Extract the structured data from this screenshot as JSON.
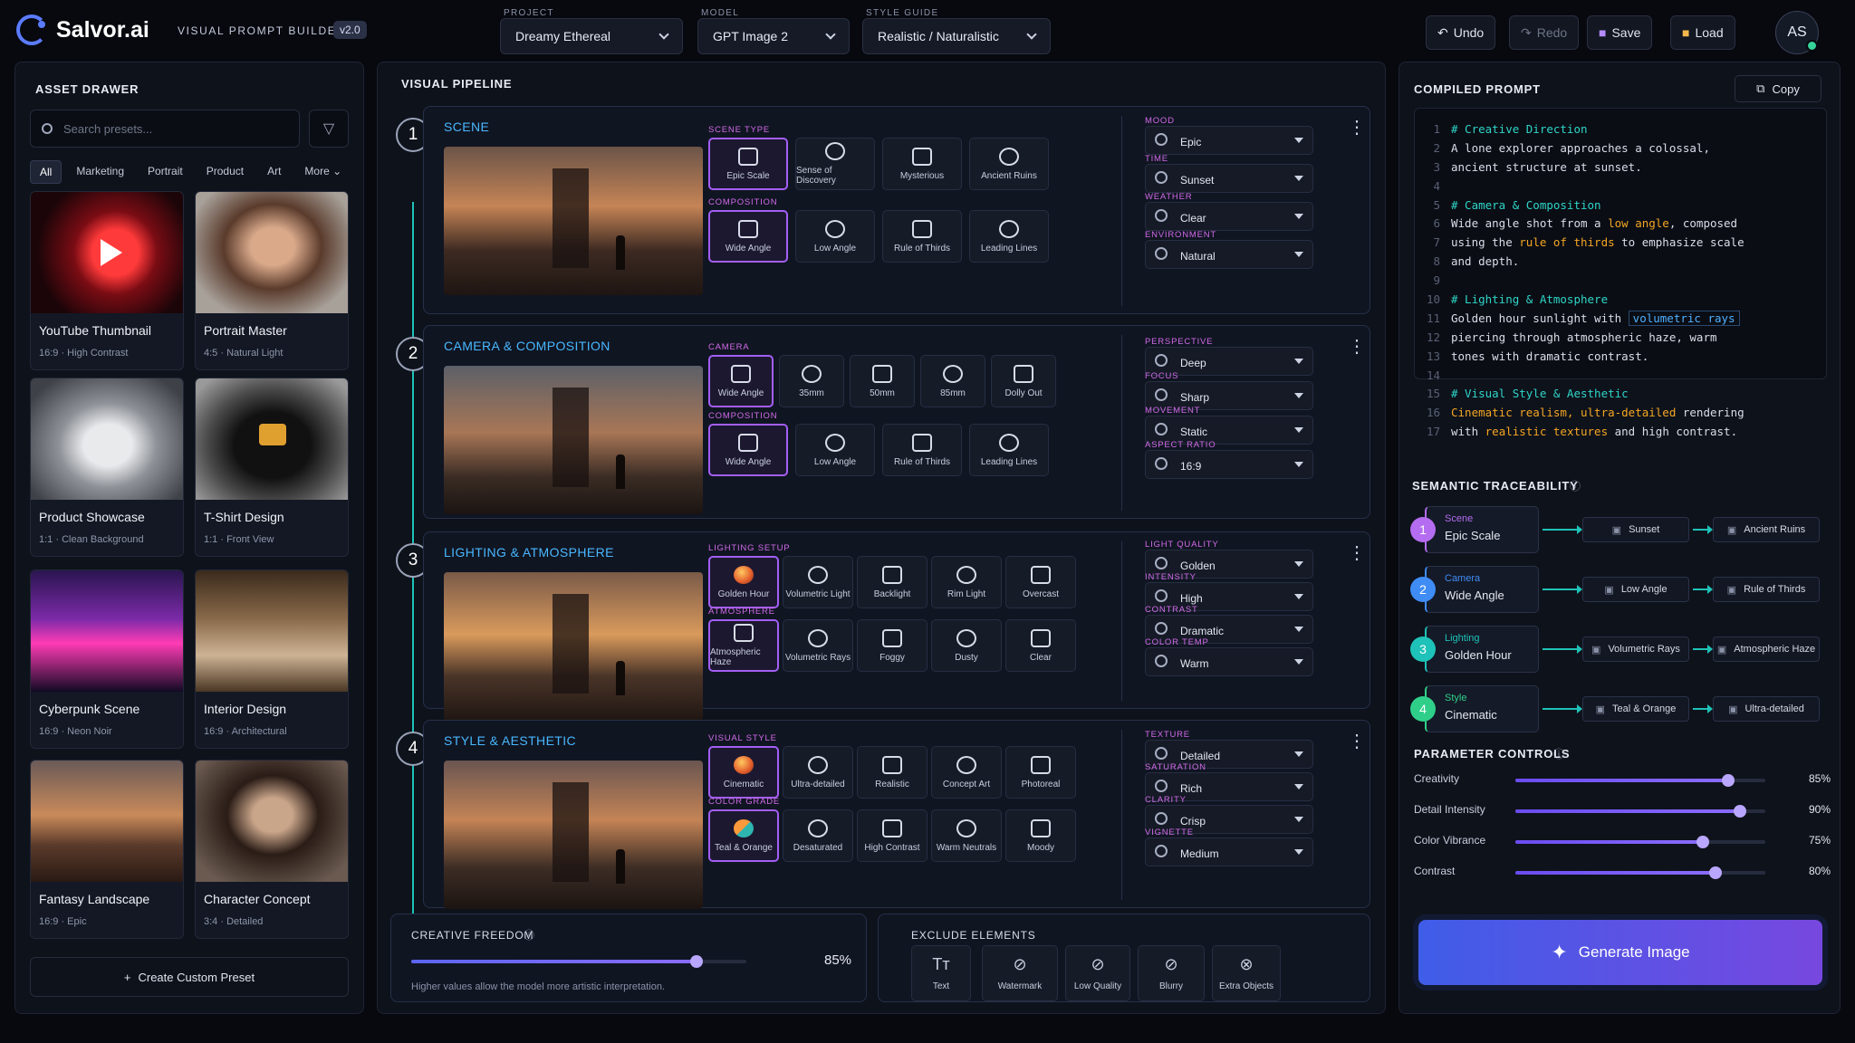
{
  "header": {
    "app_name": "Salvor.ai",
    "tool_name": "VISUAL PROMPT BUILDER",
    "version": "v2.0",
    "project_label": "PROJECT",
    "project_value": "Dreamy Ethereal",
    "model_label": "MODEL",
    "model_value": "GPT Image 2",
    "style_label": "STYLE GUIDE",
    "style_value": "Realistic / Naturalistic",
    "undo": "Undo",
    "redo": "Redo",
    "save": "Save",
    "load": "Load",
    "avatar": "AS"
  },
  "assets": {
    "title": "ASSET DRAWER",
    "search_placeholder": "Search presets...",
    "filters": [
      "All",
      "Marketing",
      "Portrait",
      "Product",
      "Art",
      "More"
    ],
    "cards": [
      {
        "title": "YouTube Thumbnail",
        "sub": "16:9 · High Contrast"
      },
      {
        "title": "Portrait Master",
        "sub": "4:5 · Natural Light"
      },
      {
        "title": "Product Showcase",
        "sub": "1:1 · Clean Background"
      },
      {
        "title": "T-Shirt Design",
        "sub": "1:1 · Front View"
      },
      {
        "title": "Cyberpunk Scene",
        "sub": "16:9 · Neon Noir"
      },
      {
        "title": "Interior Design",
        "sub": "16:9 · Architectural"
      },
      {
        "title": "Fantasy Landscape",
        "sub": "16:9 · Epic"
      },
      {
        "title": "Character Concept",
        "sub": "3:4 · Detailed"
      }
    ],
    "create": "Create Custom Preset"
  },
  "pipeline": {
    "title": "VISUAL PIPELINE",
    "stages": [
      {
        "num": "1",
        "title": "SCENE",
        "groups": [
          {
            "label": "SCENE TYPE",
            "options": [
              "Epic Scale",
              "Sense of Discovery",
              "Mysterious",
              "Ancient Ruins"
            ]
          },
          {
            "label": "COMPOSITION",
            "options": [
              "Wide Angle",
              "Low Angle",
              "Rule of Thirds",
              "Leading Lines"
            ]
          }
        ],
        "params": [
          {
            "label": "MOOD",
            "value": "Epic"
          },
          {
            "label": "TIME",
            "value": "Sunset"
          },
          {
            "label": "WEATHER",
            "value": "Clear"
          },
          {
            "label": "ENVIRONMENT",
            "value": "Natural"
          }
        ]
      },
      {
        "num": "2",
        "title": "CAMERA & COMPOSITION",
        "groups": [
          {
            "label": "CAMERA",
            "options": [
              "Wide Angle",
              "35mm",
              "50mm",
              "85mm",
              "Dolly Out"
            ]
          },
          {
            "label": "COMPOSITION",
            "options": [
              "Wide Angle",
              "Low Angle",
              "Rule of Thirds",
              "Leading Lines"
            ]
          }
        ],
        "params": [
          {
            "label": "PERSPECTIVE",
            "value": "Deep"
          },
          {
            "label": "FOCUS",
            "value": "Sharp"
          },
          {
            "label": "MOVEMENT",
            "value": "Static"
          },
          {
            "label": "ASPECT RATIO",
            "value": "16:9"
          }
        ]
      },
      {
        "num": "3",
        "title": "LIGHTING & ATMOSPHERE",
        "groups": [
          {
            "label": "LIGHTING SETUP",
            "options": [
              "Golden Hour",
              "Volumetric Light",
              "Backlight",
              "Rim Light",
              "Overcast"
            ]
          },
          {
            "label": "ATMOSPHERE",
            "options": [
              "Atmospheric Haze",
              "Volumetric Rays",
              "Foggy",
              "Dusty",
              "Clear"
            ]
          }
        ],
        "params": [
          {
            "label": "LIGHT QUALITY",
            "value": "Golden"
          },
          {
            "label": "INTENSITY",
            "value": "High"
          },
          {
            "label": "CONTRAST",
            "value": "Dramatic"
          },
          {
            "label": "COLOR TEMP",
            "value": "Warm"
          }
        ]
      },
      {
        "num": "4",
        "title": "STYLE & AESTHETIC",
        "groups": [
          {
            "label": "VISUAL STYLE",
            "options": [
              "Cinematic",
              "Ultra-detailed",
              "Realistic",
              "Concept Art",
              "Photoreal"
            ]
          },
          {
            "label": "COLOR GRADE",
            "options": [
              "Teal & Orange",
              "Desaturated",
              "High Contrast",
              "Warm Neutrals",
              "Moody"
            ]
          }
        ],
        "params": [
          {
            "label": "TEXTURE",
            "value": "Detailed"
          },
          {
            "label": "SATURATION",
            "value": "Rich"
          },
          {
            "label": "CLARITY",
            "value": "Crisp"
          },
          {
            "label": "VIGNETTE",
            "value": "Medium"
          }
        ]
      }
    ],
    "freedom_label": "CREATIVE FREEDOM",
    "freedom_value": "85%",
    "freedom_level": 0.85,
    "freedom_hint": "Higher values allow the model more artistic interpretation.",
    "exclude_label": "EXCLUDE ELEMENTS",
    "exclude": [
      "Text",
      "Watermark",
      "Low Quality",
      "Blurry",
      "Extra Objects"
    ]
  },
  "prompt": {
    "title": "COMPILED PROMPT",
    "copy": "Copy",
    "lines": [
      "# Creative Direction",
      "A lone explorer approaches a colossal,",
      "ancient structure at sunset.",
      "",
      "# Camera & Composition",
      "Wide angle shot from a low angle, composed",
      "using the rule of thirds to emphasize scale",
      "and depth.",
      "",
      "# Lighting & Atmosphere",
      "Golden hour sunlight with volumetric rays",
      "piercing through atmospheric haze, warm",
      "tones with dramatic contrast.",
      "",
      "# Visual Style & Aesthetic",
      "Cinematic realism, ultra-detailed rendering",
      "with realistic textures and high contrast."
    ]
  },
  "trace": {
    "title": "SEMANTIC TRACEABILITY",
    "rows": [
      {
        "num": "1",
        "cat": "Scene",
        "val": "Epic Scale",
        "a": "Sunset",
        "b": "Ancient Ruins",
        "color": "#b46cf0"
      },
      {
        "num": "2",
        "cat": "Camera",
        "val": "Wide Angle",
        "a": "Low Angle",
        "b": "Rule of Thirds",
        "color": "#3f8cf5"
      },
      {
        "num": "3",
        "cat": "Lighting",
        "val": "Golden Hour",
        "a": "Volumetric Rays",
        "b": "Atmospheric Haze",
        "color": "#1ec2b8"
      },
      {
        "num": "4",
        "cat": "Style",
        "val": "Cinematic",
        "a": "Teal & Orange",
        "b": "Ultra-detailed",
        "color": "#2fcf8a"
      }
    ]
  },
  "params": {
    "title": "PARAMETER CONTROLS",
    "items": [
      {
        "label": "Creativity",
        "value": "85%",
        "level": 0.85
      },
      {
        "label": "Detail Intensity",
        "value": "90%",
        "level": 0.9
      },
      {
        "label": "Color Vibrance",
        "value": "75%",
        "level": 0.75
      },
      {
        "label": "Contrast",
        "value": "80%",
        "level": 0.8
      }
    ]
  },
  "generate": "Generate Image",
  "colors": {
    "accent": "#a35ff5",
    "teal": "#1ec2b8",
    "stage_title": "#48b8ff"
  }
}
